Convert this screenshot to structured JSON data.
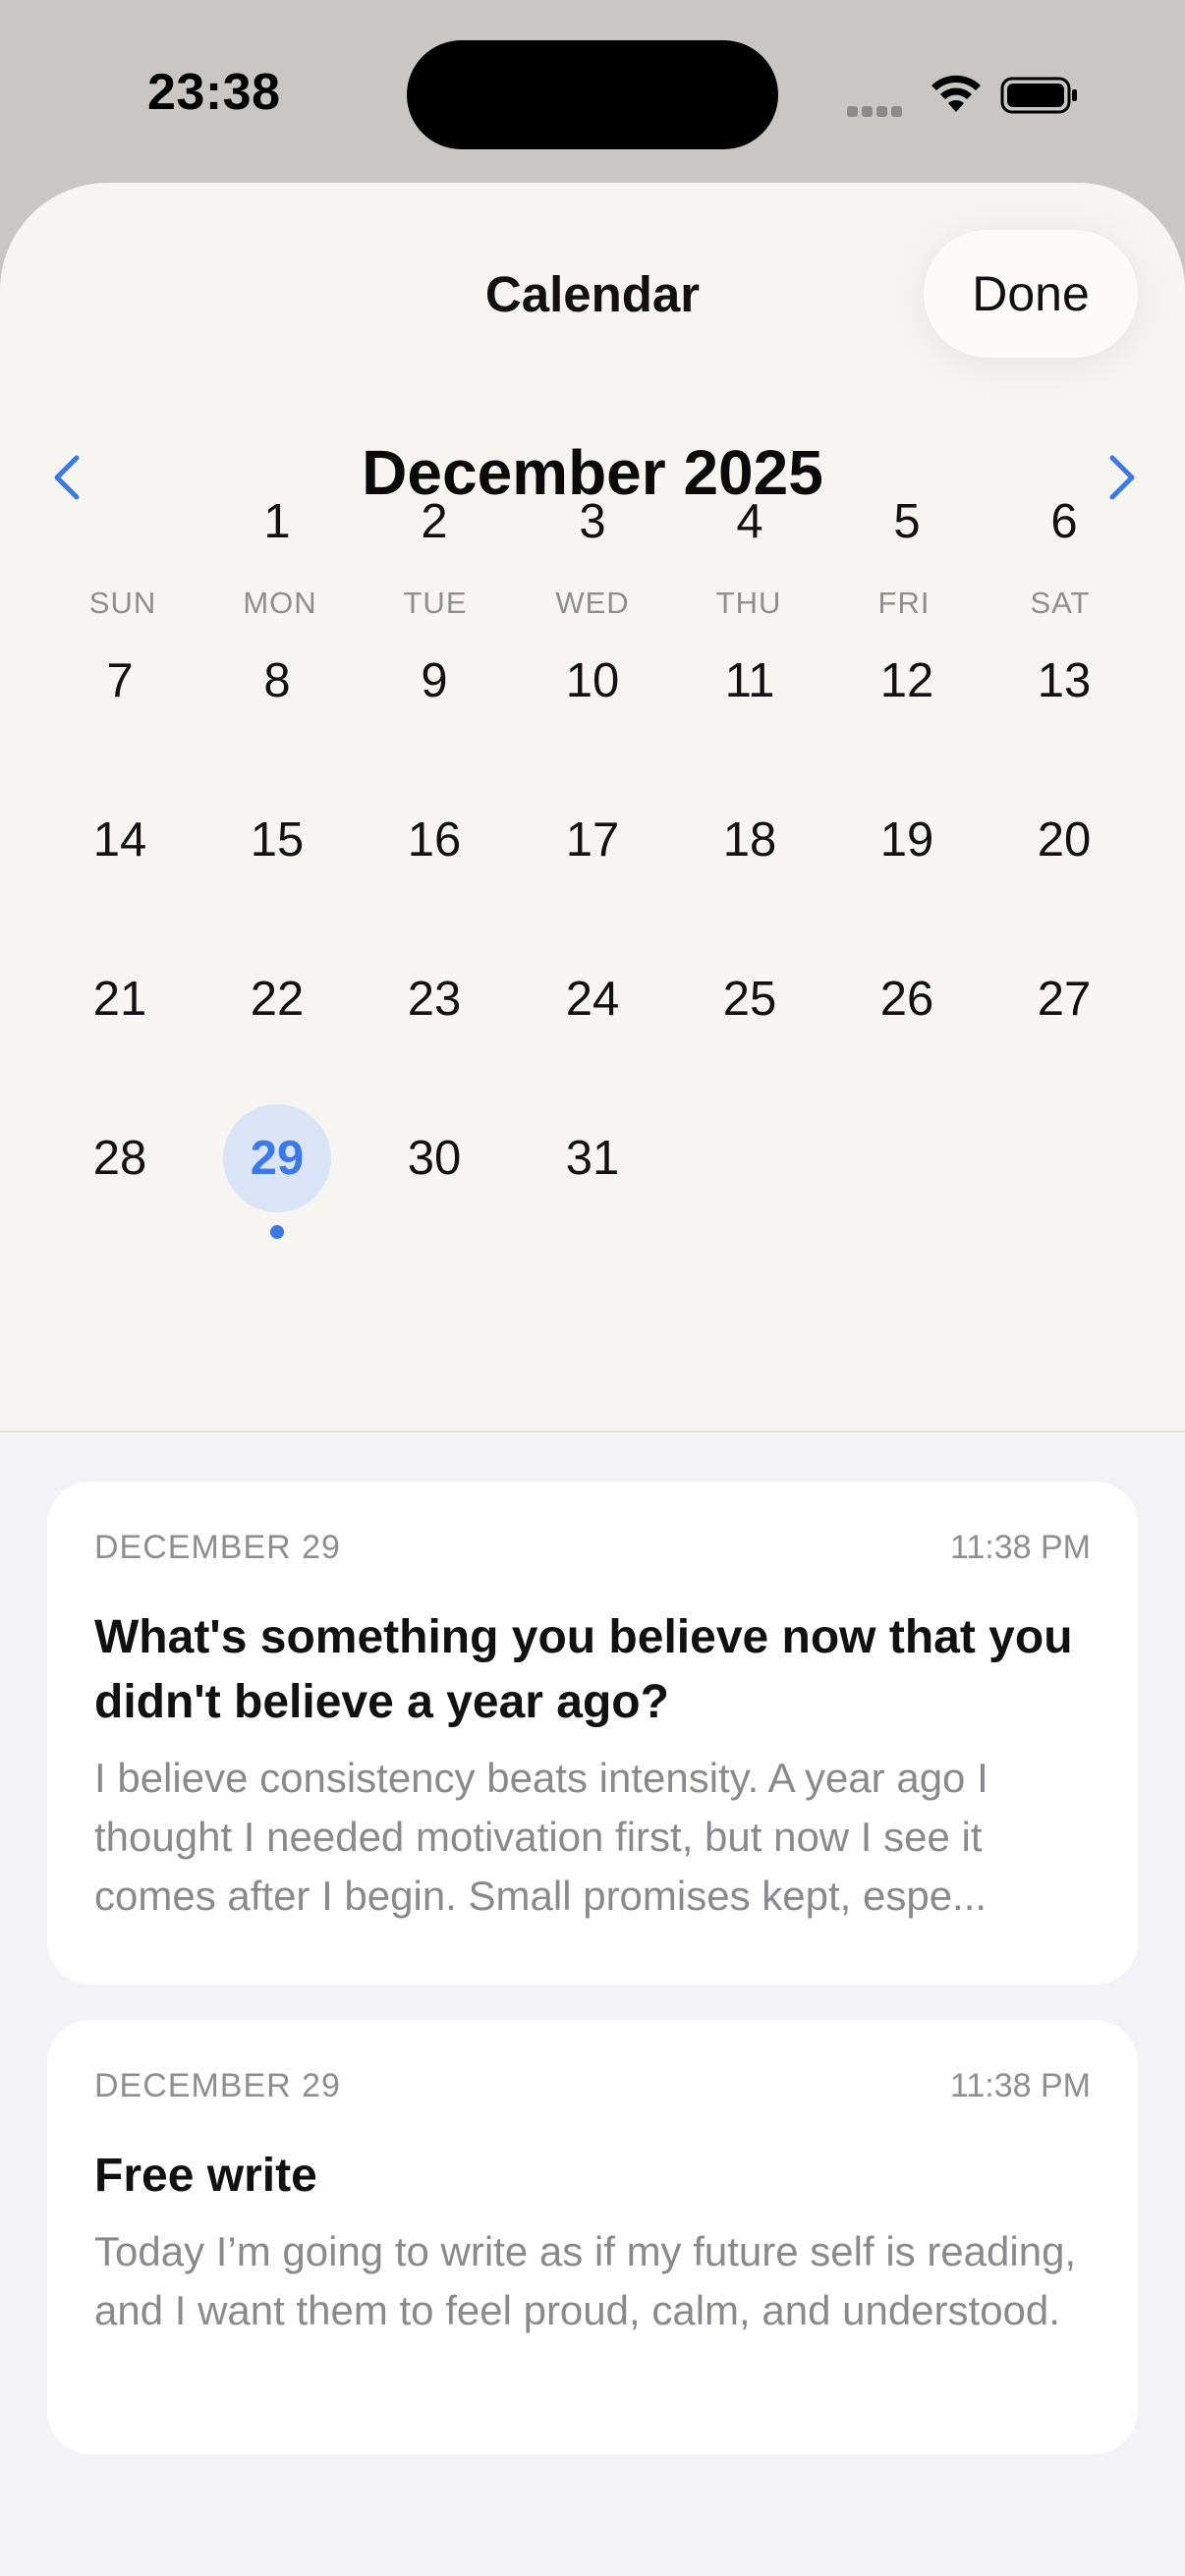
{
  "status_bar": {
    "time": "23:38",
    "icons": [
      "cellular-signal-icon",
      "wifi-icon",
      "battery-icon"
    ]
  },
  "sheet": {
    "title": "Calendar",
    "done_label": "Done"
  },
  "calendar": {
    "month_title": "December 2025",
    "prev_icon": "chevron-left-icon",
    "next_icon": "chevron-right-icon",
    "weekdays": [
      "SUN",
      "MON",
      "TUE",
      "WED",
      "THU",
      "FRI",
      "SAT"
    ],
    "first_weekday_index": 1,
    "days_in_month": 31,
    "selected_day": "29",
    "days_with_entries": [
      "29"
    ],
    "days": [
      "1",
      "2",
      "3",
      "4",
      "5",
      "6",
      "7",
      "8",
      "9",
      "10",
      "11",
      "12",
      "13",
      "14",
      "15",
      "16",
      "17",
      "18",
      "19",
      "20",
      "21",
      "22",
      "23",
      "24",
      "25",
      "26",
      "27",
      "28",
      "29",
      "30",
      "31"
    ]
  },
  "entries": [
    {
      "date": "DECEMBER 29",
      "time": "11:38 PM",
      "title": "What's something you believe now that you didn't believe a year ago?",
      "body": "I believe consistency beats intensity. A year ago I thought I needed motivation first, but now I see it comes after I begin. Small promises kept, espe..."
    },
    {
      "date": "DECEMBER 29",
      "time": "11:38 PM",
      "title": "Free write",
      "body": "Today I’m going to write as if my future self is reading, and I want them to feel proud, calm, and understood."
    }
  ],
  "colors": {
    "accent": "#3b79e6",
    "selected_bg": "#dbe3f6",
    "sheet_bg": "#f6f5f2",
    "list_bg": "#f2f2f7"
  }
}
